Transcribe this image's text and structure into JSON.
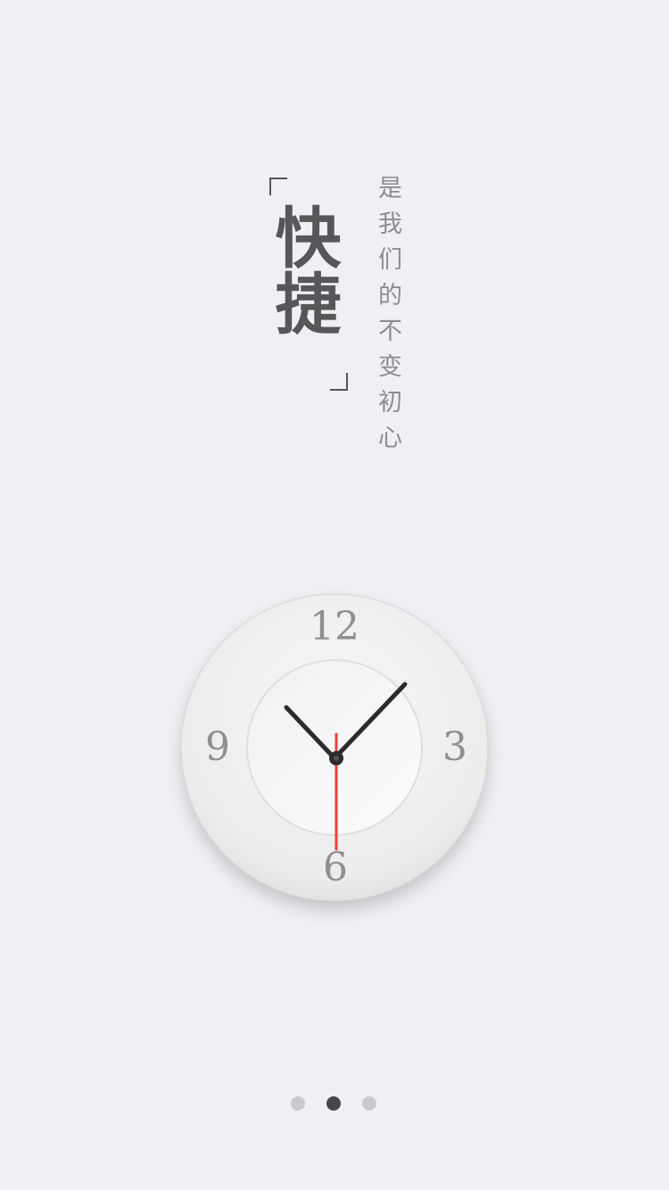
{
  "headline": {
    "title": "快捷",
    "subtitle": "是我们的不变初心"
  },
  "clock": {
    "numerals": {
      "twelve": "12",
      "three": "3",
      "six": "6",
      "nine": "9"
    },
    "colors": {
      "hands": "#2b2b2e",
      "second_hand": "#e8413f",
      "dial": "#efefef"
    }
  },
  "pager": {
    "page_count": 3,
    "active_page": 2
  }
}
